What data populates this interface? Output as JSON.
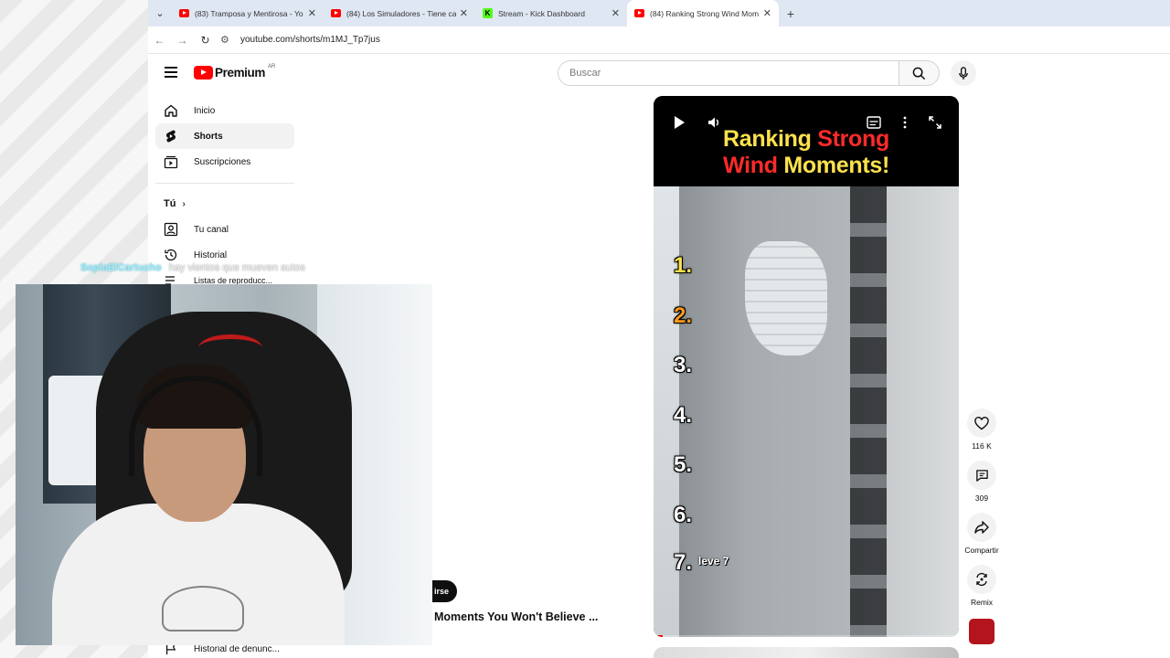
{
  "browser": {
    "tabs": [
      {
        "title": "(83) Tramposa y Mentirosa - Yo",
        "favicon": "youtube-icon",
        "active": false
      },
      {
        "title": "(84) Los Simuladores - Tiene ca",
        "favicon": "youtube-icon",
        "active": false
      },
      {
        "title": "Stream - Kick Dashboard",
        "favicon": "kick-icon",
        "active": false
      },
      {
        "title": "(84) Ranking Strong Wind Mom",
        "favicon": "youtube-icon",
        "active": true
      }
    ],
    "url": "youtube.com/shorts/m1MJ_Tp7jus"
  },
  "masthead": {
    "logo_text": "Premium",
    "country_code": "AR",
    "search_placeholder": "Buscar"
  },
  "sidebar": {
    "items": [
      {
        "label": "Inicio",
        "icon": "home-icon"
      },
      {
        "label": "Shorts",
        "icon": "shorts-icon"
      },
      {
        "label": "Suscripciones",
        "icon": "subscriptions-icon"
      }
    ],
    "you_section": "Tú",
    "you_items": [
      {
        "label": "Tu canal",
        "icon": "channel-icon"
      },
      {
        "label": "Historial",
        "icon": "history-icon"
      },
      {
        "label": "Listas de reproducc...",
        "icon": "playlists-icon"
      }
    ],
    "bottom_item": "Historial de denunc..."
  },
  "chat": {
    "username": "SoplaElCartucho",
    "message": "hay vientos que mueven autos"
  },
  "short": {
    "title_line1_a": "Ranking ",
    "title_line1_b": "Strong",
    "title_line2_a": "Wind ",
    "title_line2_b": "Moments!",
    "ranks": [
      "1.",
      "2.",
      "3.",
      "4.",
      "5.",
      "6.",
      "7."
    ],
    "rank7_note": "leve 7",
    "subscribe_label": "irse",
    "visible_title": "Moments You Won't Believe ...",
    "progress": 0.03
  },
  "actions": {
    "likes": "116 K",
    "comments": "309",
    "share": "Compartir",
    "remix": "Remix"
  },
  "colors": {
    "yt_red": "#ff0000",
    "title_yellow": "#fde24d",
    "title_red": "#ff2a2a",
    "kick_green": "#53fc18"
  }
}
